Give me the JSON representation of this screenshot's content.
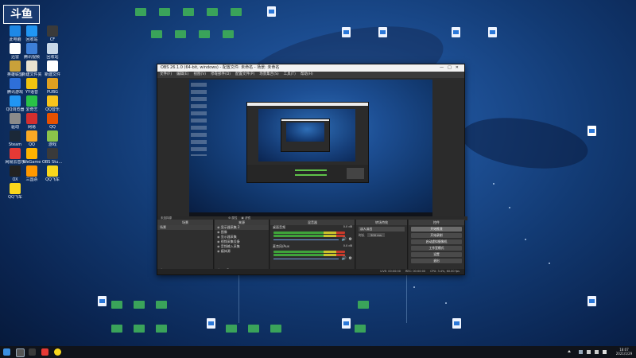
{
  "desktop": {
    "icons_left": [
      {
        "label": "此电脑",
        "color": "#1e88e5"
      },
      {
        "label": "回收站",
        "color": "#2196f3"
      },
      {
        "label": "CF",
        "color": "#3a3a3a"
      },
      {
        "label": "迅雷",
        "color": "#ffffff"
      },
      {
        "label": "腾讯视频",
        "color": "#3d7fd8"
      },
      {
        "label": "回收站",
        "color": "#c8d8e8"
      },
      {
        "label": "英雄联盟",
        "color": "#c9a13a"
      },
      {
        "label": "新建文件夹",
        "color": "#e8e2d0"
      },
      {
        "label": "新建文件",
        "color": "#ffffff"
      },
      {
        "label": "腾讯游戏",
        "color": "#2e6fd8"
      },
      {
        "label": "YY语音",
        "color": "#f1c40f"
      },
      {
        "label": "PUBG",
        "color": "#e0a020"
      },
      {
        "label": "QQ浏览器",
        "color": "#2196f3"
      },
      {
        "label": "爱奇艺",
        "color": "#29c247"
      },
      {
        "label": "QQ音乐",
        "color": "#f7c31c"
      },
      {
        "label": "驱动",
        "color": "#8a8a8a"
      },
      {
        "label": "网易",
        "color": "#d32f2f"
      },
      {
        "label": "QQ",
        "color": "#e65100"
      },
      {
        "label": "Steam",
        "color": "#1b2838"
      },
      {
        "label": "QQ",
        "color": "#f9a825"
      },
      {
        "label": "游戏",
        "color": "#8bc34a"
      },
      {
        "label": "网易云音乐",
        "color": "#e53935"
      },
      {
        "label": "WeGame",
        "color": "#ffb300"
      },
      {
        "label": "OBS Studio",
        "color": "#3a3a3a"
      },
      {
        "label": "OX",
        "color": "#222222"
      },
      {
        "label": "三国杀",
        "color": "#ff9800"
      },
      {
        "label": "QQ飞车",
        "color": "#f9d71c"
      },
      {
        "label": "QQ飞车",
        "color": "#f9d71c"
      }
    ],
    "logo_text": "斗鱼"
  },
  "obs": {
    "title": "OBS 26.1.0 (64-bit, windows) - 配置文件: 未命名 - 场景: 未命名",
    "menu": [
      "文件(F)",
      "编辑(E)",
      "视图(V)",
      "停靠部件(D)",
      "配置文件(P)",
      "场景集合(S)",
      "工具(T)",
      "帮助(H)"
    ],
    "no_source": "未选择源",
    "properties": "属性",
    "filters": "滤镜",
    "docks": {
      "scenes_title": "场景",
      "scene_item": "场景",
      "sources_title": "来源",
      "sources": [
        "显示器采集 2",
        "图像",
        "显示器采集",
        "视频采集设备",
        "音频输入采集",
        "媒体源"
      ],
      "mixer_title": "混音器",
      "mixer_tracks": [
        {
          "name": "桌面音频",
          "level": "0.0 dB"
        },
        {
          "name": "麦克风/Aux",
          "level": "0.0 dB"
        }
      ],
      "transition_title": "转场特效",
      "transition_value": "淡入淡出",
      "duration_label": "时长",
      "duration_value": "300 ms",
      "controls_title": "控件",
      "controls": [
        "开始推流",
        "开始录制",
        "启动虚拟摄像机",
        "工作室模式",
        "设置",
        "退出"
      ]
    },
    "status": [
      "LIVE: 00:00:00",
      "REC: 00:00:00",
      "CPU: 3.4%, 60.00 fps"
    ]
  },
  "taskbar": {
    "time": "18:07",
    "date": "2021/1/29"
  }
}
